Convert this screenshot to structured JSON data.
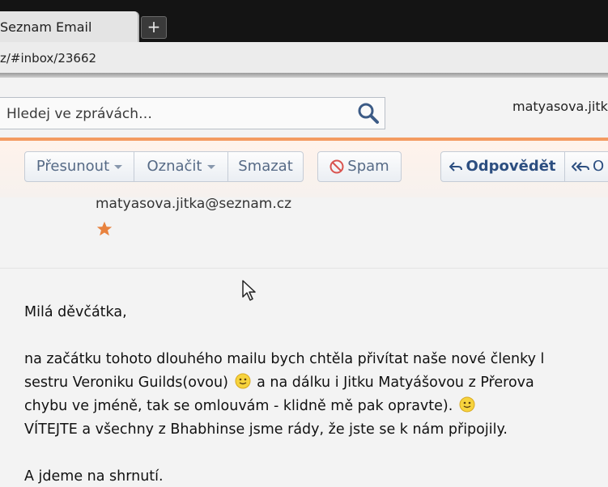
{
  "browser": {
    "tab_title": "Seznam Email",
    "new_tab_label": "+",
    "url": "z/#inbox/23662"
  },
  "search": {
    "placeholder": "Hledej ve zprávách…"
  },
  "user": {
    "name": "matyasova.jitk"
  },
  "toolbar": {
    "move_label": "Přesunout",
    "mark_label": "Označit",
    "delete_label": "Smazat",
    "spam_label": "Spam",
    "reply_label": "Odpovědět",
    "reply_all_label": "O"
  },
  "message": {
    "sender_email": "matyasova.jitka@seznam.cz",
    "body": {
      "greeting": "Milá děvčátka,",
      "line1": "na začátku tohoto dlouhého mailu bych chtěla přivítat naše nové členky l",
      "line2a": "sestru Veroniku Guilds(ovou)",
      "line2b": "a na dálku i Jitku Matyášovou z Přerova",
      "line3a": "chybu ve jméně, tak se omlouvám - klidně mě pak opravte).",
      "line4": "VÍTEJTE  a všechny z Bhabhinse jsme rády, že jste se k nám připojily.",
      "line5": "A jdeme na shrnutí."
    }
  },
  "colors": {
    "accent_orange": "#f39b61",
    "star": "#e8823e",
    "button_text": "#566a86",
    "reply_text": "#2c4e80",
    "spam_icon": "#d9534f"
  },
  "icons": {
    "search": "search-icon",
    "caret": "chevron-down-icon",
    "spam": "no-entry-icon",
    "reply": "reply-arrow-icon",
    "reply_all": "reply-all-arrow-icon",
    "star": "star-icon",
    "smiley": "smiley-emoji-icon",
    "cursor": "mouse-pointer-icon"
  }
}
